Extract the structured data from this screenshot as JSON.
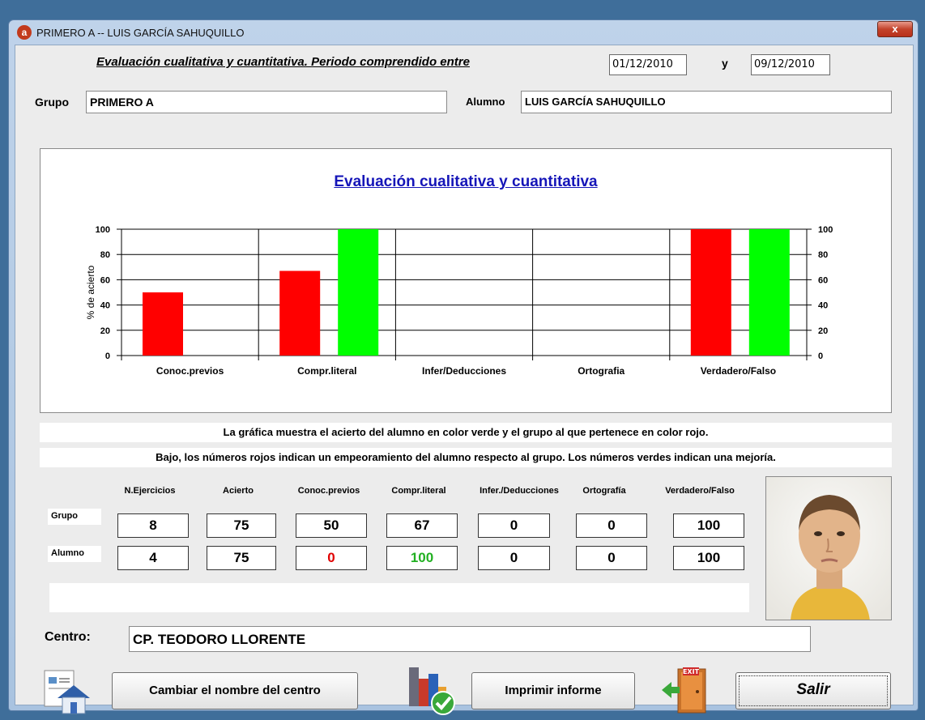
{
  "window": {
    "title": "PRIMERO A  --  LUIS GARCÍA SAHUQUILLO",
    "app_icon": "a",
    "close_label": "x"
  },
  "header": {
    "heading": "Evaluación cualitativa y cuantitativa. Periodo comprendido entre",
    "date_from": "01/12/2010",
    "conjunction": "y",
    "date_to": "09/12/2010"
  },
  "group": {
    "label": "Grupo",
    "value": "PRIMERO A"
  },
  "student": {
    "label": "Alumno",
    "value": "LUIS GARCÍA SAHUQUILLO"
  },
  "chart_data": {
    "type": "bar",
    "title": "Evaluación cualitativa y cuantitativa",
    "ylabel": "% de acierto",
    "xlabel": "",
    "ylim": [
      0,
      100
    ],
    "yticks": [
      0,
      20,
      40,
      60,
      80,
      100
    ],
    "categories": [
      "Conoc.previos",
      "Compr.literal",
      "Infer/Deducciones",
      "Ortografia",
      "Verdadero/Falso"
    ],
    "series": [
      {
        "color": "#ff0000",
        "values": [
          50,
          67,
          0,
          0,
          100
        ]
      },
      {
        "color": "#00ff00",
        "values": [
          0,
          100,
          0,
          0,
          100
        ]
      }
    ]
  },
  "notes": {
    "line1": "La gráfica muestra el acierto del alumno en color verde y el grupo al que pertenece en color rojo.",
    "line2": "Bajo, los números rojos indican un empeoramiento del alumno respecto al grupo. Los números verdes indican una mejoría."
  },
  "table": {
    "headers": [
      "N.Ejercicios",
      "Acierto",
      "Conoc.previos",
      "Compr.literal",
      "Infer./Deducciones",
      "Ortografía",
      "Verdadero/Falso"
    ],
    "rows": [
      {
        "label": "Grupo",
        "values": [
          "8",
          "75",
          "50",
          "67",
          "0",
          "0",
          "100"
        ]
      },
      {
        "label": "Alumno",
        "values": [
          "4",
          "75",
          "0",
          "100",
          "0",
          "0",
          "100"
        ]
      }
    ]
  },
  "center": {
    "label": "Centro:",
    "value": "CP. TEODORO LLORENTE"
  },
  "buttons": {
    "change_center": "Cambiar el nombre del centro",
    "print_report": "Imprimir informe",
    "exit": "Salir"
  },
  "colors": {
    "worse": "#e00000",
    "better": "#22b022",
    "title_blue": "#1515b8"
  }
}
